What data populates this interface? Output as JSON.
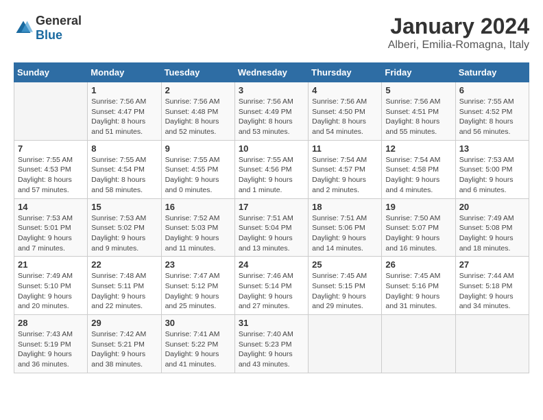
{
  "logo": {
    "general": "General",
    "blue": "Blue"
  },
  "title": "January 2024",
  "subtitle": "Alberi, Emilia-Romagna, Italy",
  "weekdays": [
    "Sunday",
    "Monday",
    "Tuesday",
    "Wednesday",
    "Thursday",
    "Friday",
    "Saturday"
  ],
  "weeks": [
    [
      {
        "day": "",
        "info": ""
      },
      {
        "day": "1",
        "info": "Sunrise: 7:56 AM\nSunset: 4:47 PM\nDaylight: 8 hours\nand 51 minutes."
      },
      {
        "day": "2",
        "info": "Sunrise: 7:56 AM\nSunset: 4:48 PM\nDaylight: 8 hours\nand 52 minutes."
      },
      {
        "day": "3",
        "info": "Sunrise: 7:56 AM\nSunset: 4:49 PM\nDaylight: 8 hours\nand 53 minutes."
      },
      {
        "day": "4",
        "info": "Sunrise: 7:56 AM\nSunset: 4:50 PM\nDaylight: 8 hours\nand 54 minutes."
      },
      {
        "day": "5",
        "info": "Sunrise: 7:56 AM\nSunset: 4:51 PM\nDaylight: 8 hours\nand 55 minutes."
      },
      {
        "day": "6",
        "info": "Sunrise: 7:55 AM\nSunset: 4:52 PM\nDaylight: 8 hours\nand 56 minutes."
      }
    ],
    [
      {
        "day": "7",
        "info": "Sunrise: 7:55 AM\nSunset: 4:53 PM\nDaylight: 8 hours\nand 57 minutes."
      },
      {
        "day": "8",
        "info": "Sunrise: 7:55 AM\nSunset: 4:54 PM\nDaylight: 8 hours\nand 58 minutes."
      },
      {
        "day": "9",
        "info": "Sunrise: 7:55 AM\nSunset: 4:55 PM\nDaylight: 9 hours\nand 0 minutes."
      },
      {
        "day": "10",
        "info": "Sunrise: 7:55 AM\nSunset: 4:56 PM\nDaylight: 9 hours\nand 1 minute."
      },
      {
        "day": "11",
        "info": "Sunrise: 7:54 AM\nSunset: 4:57 PM\nDaylight: 9 hours\nand 2 minutes."
      },
      {
        "day": "12",
        "info": "Sunrise: 7:54 AM\nSunset: 4:58 PM\nDaylight: 9 hours\nand 4 minutes."
      },
      {
        "day": "13",
        "info": "Sunrise: 7:53 AM\nSunset: 5:00 PM\nDaylight: 9 hours\nand 6 minutes."
      }
    ],
    [
      {
        "day": "14",
        "info": "Sunrise: 7:53 AM\nSunset: 5:01 PM\nDaylight: 9 hours\nand 7 minutes."
      },
      {
        "day": "15",
        "info": "Sunrise: 7:53 AM\nSunset: 5:02 PM\nDaylight: 9 hours\nand 9 minutes."
      },
      {
        "day": "16",
        "info": "Sunrise: 7:52 AM\nSunset: 5:03 PM\nDaylight: 9 hours\nand 11 minutes."
      },
      {
        "day": "17",
        "info": "Sunrise: 7:51 AM\nSunset: 5:04 PM\nDaylight: 9 hours\nand 13 minutes."
      },
      {
        "day": "18",
        "info": "Sunrise: 7:51 AM\nSunset: 5:06 PM\nDaylight: 9 hours\nand 14 minutes."
      },
      {
        "day": "19",
        "info": "Sunrise: 7:50 AM\nSunset: 5:07 PM\nDaylight: 9 hours\nand 16 minutes."
      },
      {
        "day": "20",
        "info": "Sunrise: 7:49 AM\nSunset: 5:08 PM\nDaylight: 9 hours\nand 18 minutes."
      }
    ],
    [
      {
        "day": "21",
        "info": "Sunrise: 7:49 AM\nSunset: 5:10 PM\nDaylight: 9 hours\nand 20 minutes."
      },
      {
        "day": "22",
        "info": "Sunrise: 7:48 AM\nSunset: 5:11 PM\nDaylight: 9 hours\nand 22 minutes."
      },
      {
        "day": "23",
        "info": "Sunrise: 7:47 AM\nSunset: 5:12 PM\nDaylight: 9 hours\nand 25 minutes."
      },
      {
        "day": "24",
        "info": "Sunrise: 7:46 AM\nSunset: 5:14 PM\nDaylight: 9 hours\nand 27 minutes."
      },
      {
        "day": "25",
        "info": "Sunrise: 7:45 AM\nSunset: 5:15 PM\nDaylight: 9 hours\nand 29 minutes."
      },
      {
        "day": "26",
        "info": "Sunrise: 7:45 AM\nSunset: 5:16 PM\nDaylight: 9 hours\nand 31 minutes."
      },
      {
        "day": "27",
        "info": "Sunrise: 7:44 AM\nSunset: 5:18 PM\nDaylight: 9 hours\nand 34 minutes."
      }
    ],
    [
      {
        "day": "28",
        "info": "Sunrise: 7:43 AM\nSunset: 5:19 PM\nDaylight: 9 hours\nand 36 minutes."
      },
      {
        "day": "29",
        "info": "Sunrise: 7:42 AM\nSunset: 5:21 PM\nDaylight: 9 hours\nand 38 minutes."
      },
      {
        "day": "30",
        "info": "Sunrise: 7:41 AM\nSunset: 5:22 PM\nDaylight: 9 hours\nand 41 minutes."
      },
      {
        "day": "31",
        "info": "Sunrise: 7:40 AM\nSunset: 5:23 PM\nDaylight: 9 hours\nand 43 minutes."
      },
      {
        "day": "",
        "info": ""
      },
      {
        "day": "",
        "info": ""
      },
      {
        "day": "",
        "info": ""
      }
    ]
  ]
}
